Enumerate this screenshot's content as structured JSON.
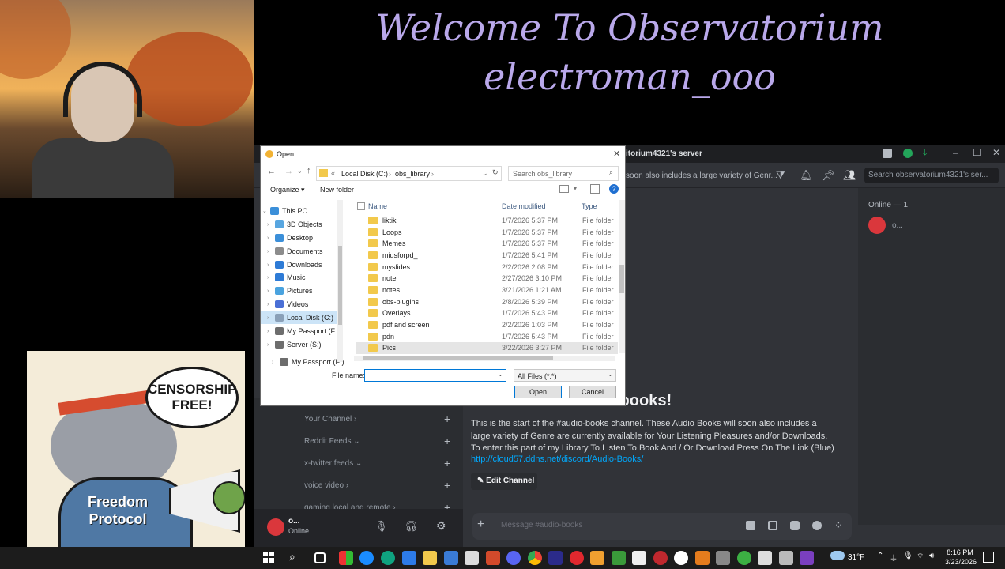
{
  "banner": {
    "line1": "Welcome To Observatorium",
    "line2": "electroman_ooo"
  },
  "sticker": {
    "bubble": "CENSORSHIP FREE!",
    "hoodie": "Freedom Protocol"
  },
  "discord": {
    "server_title": "itorium4321's server",
    "topic": "soon also includes a large variety of Genr...",
    "search_placeholder": "Search observatorium4321's ser...",
    "online_header": "Online — 1",
    "member_name": "o...",
    "welcome_heading": "Welcome to #audio-books!",
    "welcome_text": "This is the start of the #audio-books channel. These Audio Books will soon also includes a large variety of Genre are currently available for Your Listening Pleasures and/or Downloads. To enter this part of my Library To Listen To Book And / Or Download Press On The Link (Blue)",
    "link": "http://cloud57.ddns.net/discord/Audio-Books/",
    "edit_channel": "Edit Channel",
    "message_placeholder": "Message #audio-books",
    "categories": [
      {
        "label": "Your Channel ›"
      },
      {
        "label": "Reddit Feeds ⌄"
      },
      {
        "label": "x-twitter feeds ⌄"
      },
      {
        "label": "voice video ›"
      },
      {
        "label": "gaming local and remote ›"
      }
    ],
    "user": {
      "name": "o...",
      "status": "Online"
    }
  },
  "dialog": {
    "title": "Open",
    "path": [
      "Local Disk (C:)",
      "obs_library"
    ],
    "search_placeholder": "Search obs_library",
    "organize": "Organize ▾",
    "new_folder": "New folder",
    "columns": {
      "name": "Name",
      "date": "Date modified",
      "type": "Type"
    },
    "nav": [
      {
        "label": "This PC",
        "color": "#3b8fd9"
      },
      {
        "label": "3D Objects",
        "color": "#58a6e0"
      },
      {
        "label": "Desktop",
        "color": "#3b8fd9"
      },
      {
        "label": "Documents",
        "color": "#8c8c8c"
      },
      {
        "label": "Downloads",
        "color": "#2e7bd6"
      },
      {
        "label": "Music",
        "color": "#2e7bd6"
      },
      {
        "label": "Pictures",
        "color": "#4aa3df"
      },
      {
        "label": "Videos",
        "color": "#4a6fd6"
      },
      {
        "label": "Local Disk (C:)",
        "color": "#8aa0b8"
      },
      {
        "label": "My Passport (F:)",
        "color": "#6d6d6d"
      },
      {
        "label": "Server (S:)",
        "color": "#6d6d6d"
      },
      {
        "label": "My Passport (F:)",
        "color": "#6d6d6d"
      }
    ],
    "files": [
      {
        "name": "liktik",
        "date": "1/7/2026 5:37 PM",
        "type": "File folder"
      },
      {
        "name": "Loops",
        "date": "1/7/2026 5:37 PM",
        "type": "File folder"
      },
      {
        "name": "Memes",
        "date": "1/7/2026 5:37 PM",
        "type": "File folder"
      },
      {
        "name": "midsforpd_",
        "date": "1/7/2026 5:41 PM",
        "type": "File folder"
      },
      {
        "name": "myslides",
        "date": "2/2/2026 2:08 PM",
        "type": "File folder"
      },
      {
        "name": "note",
        "date": "2/27/2026 3:10 PM",
        "type": "File folder"
      },
      {
        "name": "notes",
        "date": "3/21/2026 1:21 AM",
        "type": "File folder"
      },
      {
        "name": "obs-plugins",
        "date": "2/8/2026 5:39 PM",
        "type": "File folder"
      },
      {
        "name": "Overlays",
        "date": "1/7/2026 5:43 PM",
        "type": "File folder"
      },
      {
        "name": "pdf and screen",
        "date": "2/2/2026 1:03 PM",
        "type": "File folder"
      },
      {
        "name": "pdn",
        "date": "1/7/2026 5:43 PM",
        "type": "File folder"
      },
      {
        "name": "Pics",
        "date": "3/22/2026 3:27 PM",
        "type": "File folder"
      }
    ],
    "file_name_label": "File name:",
    "file_name_value": "",
    "filter": "All Files (*.*)",
    "open": "Open",
    "cancel": "Cancel"
  },
  "taskbar": {
    "temperature": "31°F",
    "time": "8:16 PM",
    "date": "3/23/2026"
  }
}
